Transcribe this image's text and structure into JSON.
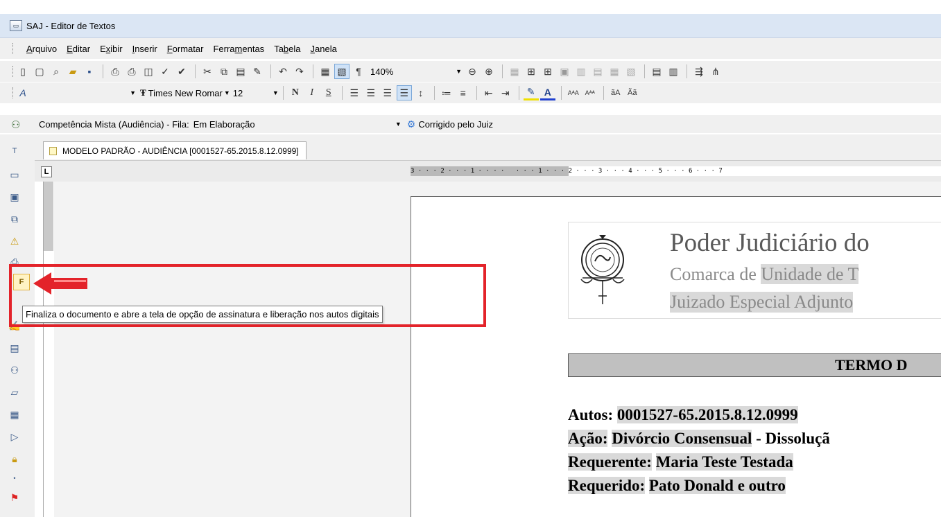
{
  "window": {
    "title": "SAJ - Editor de Textos",
    "app_icon": "window-app-icon"
  },
  "menu": [
    {
      "label": "Arquivo",
      "accel": "A"
    },
    {
      "label": "Editar",
      "accel": "E"
    },
    {
      "label": "Exibir",
      "accel": "x"
    },
    {
      "label": "Inserir",
      "accel": "I"
    },
    {
      "label": "Formatar",
      "accel": "F"
    },
    {
      "label": "Ferramentas",
      "accel": "m"
    },
    {
      "label": "Tabela",
      "accel": "b"
    },
    {
      "label": "Janela",
      "accel": "J"
    }
  ],
  "toolbar": {
    "pilcrow": "¶",
    "zoom": "140%"
  },
  "format_toolbar": {
    "style_value": "",
    "font_name": "Times New Romar",
    "font_size": "12",
    "bold": "N",
    "italic": "I",
    "underline": "S",
    "text_color_letter": "A"
  },
  "status": {
    "queue_text": "Competência Mista (Audiência) - Fila:",
    "queue_value": "Em Elaboração",
    "corrected_label": "Corrigido pelo Juiz"
  },
  "document_tab": {
    "label": "MODELO PADRÃO - AUDIÊNCIA [0001527-65.2015.8.12.0999]"
  },
  "ruler": {
    "tab_stop_label": "L",
    "numbers": "3 · · · 2 · · · 1 · · · ·   · · · 1 · · · 2 · · · 3 · · · 4 · · · 5 · · · 6 · · · 7"
  },
  "document": {
    "court_name": "Poder Judiciário do",
    "comarca_prefix": "Comarca de",
    "comarca_value": "Unidade de T",
    "juizado": "Juizado Especial Adjunto",
    "termo_title": "TERMO D",
    "fields": [
      {
        "label": "Autos:",
        "value": "0001527-65.2015.8.12.0999"
      },
      {
        "label": "Ação:",
        "value": "Divórcio Consensual",
        "suffix": "- Dissoluçã"
      },
      {
        "label": "Requerente:",
        "value": "Maria Teste Testada"
      },
      {
        "label": "Requerido:",
        "value": "Pato Donald e outro"
      }
    ]
  },
  "tooltip": {
    "text": "Finaliza o documento e abre a tela de opção de assinatura e liberação nos autos digitais"
  },
  "finalize_button": {
    "label": "F"
  },
  "colors": {
    "annotation_red": "#e3232a",
    "title_bar": "#dbe6f4",
    "toolbar_bg": "#f0f0f0",
    "field_highlight": "#d9d9d9"
  }
}
